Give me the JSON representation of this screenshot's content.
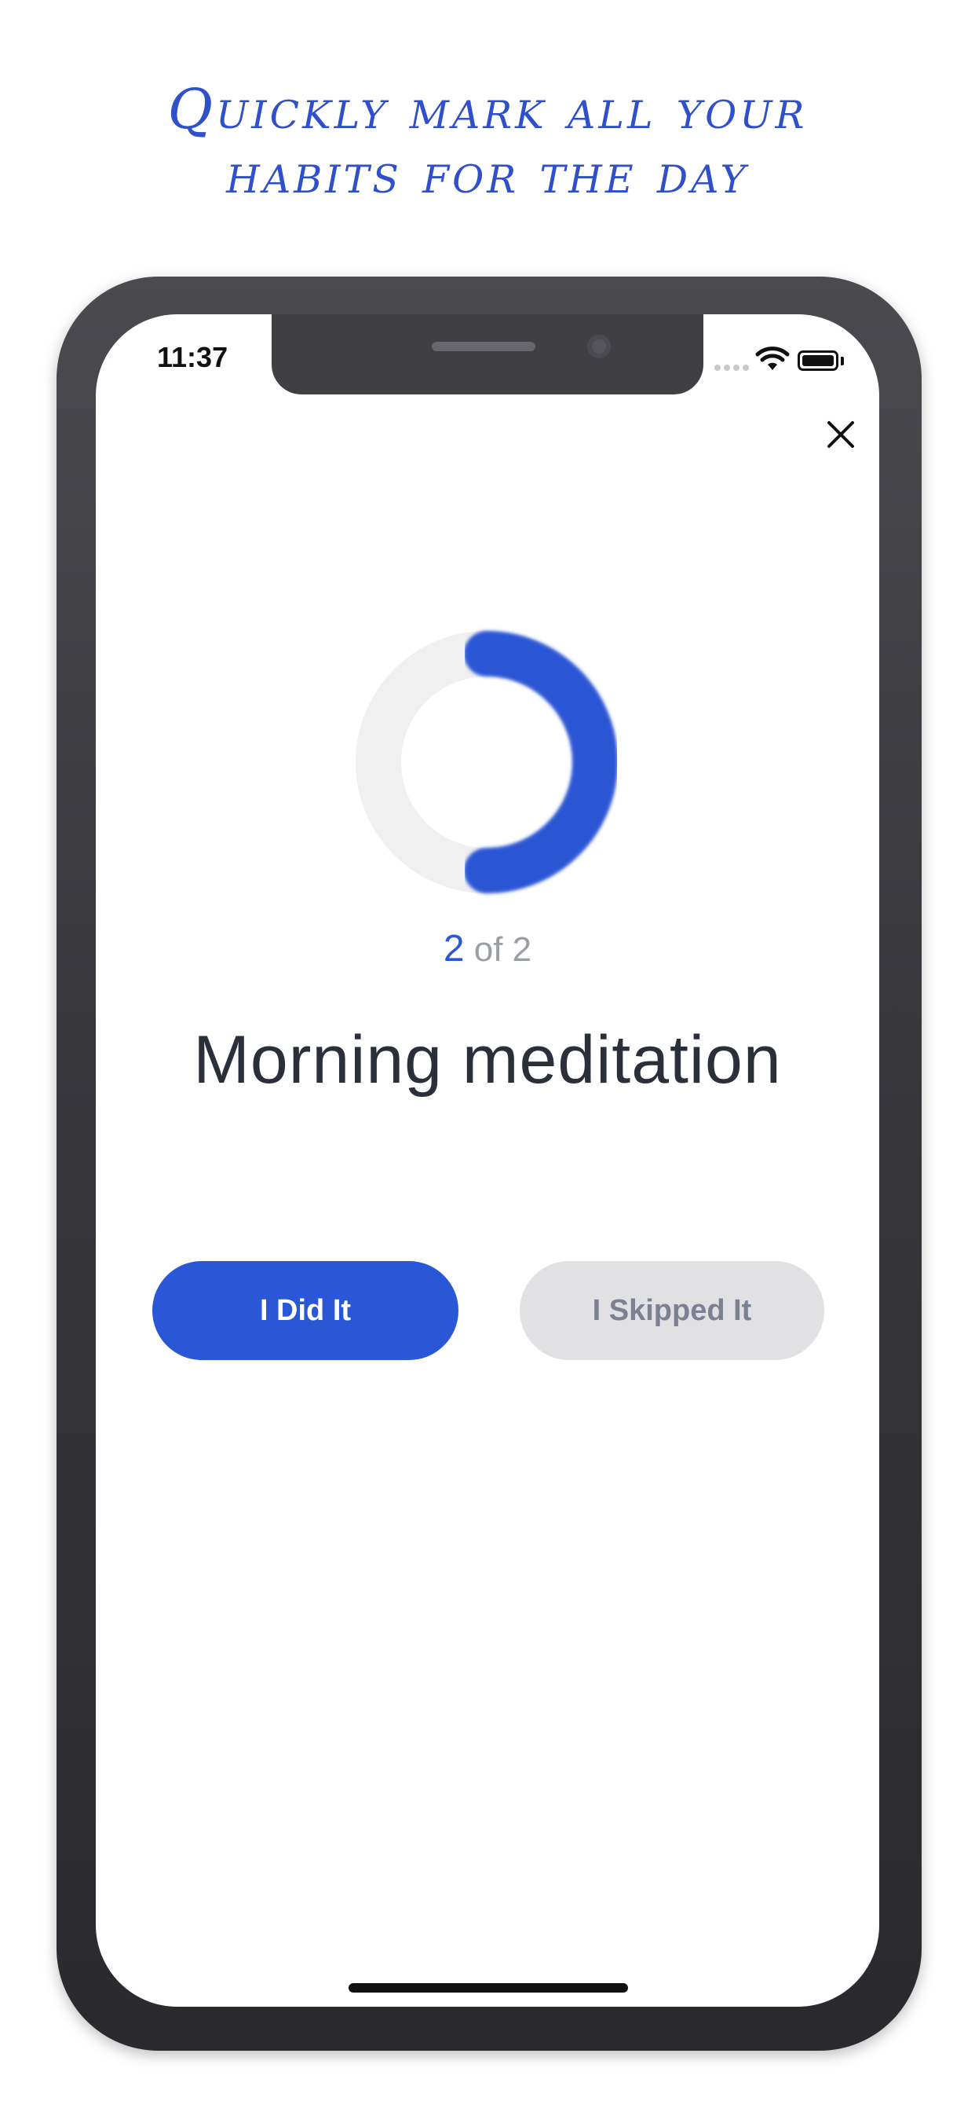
{
  "headline": {
    "line1": "Quickly mark all your",
    "line2": "habits for the day"
  },
  "status_bar": {
    "time": "11:37",
    "icons": [
      "signal-dots-icon",
      "wifi-icon",
      "battery-icon"
    ]
  },
  "header": {
    "close_icon": "close-icon"
  },
  "progress": {
    "current": "2",
    "separator": "of 2",
    "fraction_complete": 0.5,
    "accent_color": "#2a57d6",
    "track_color": "#f0f0f0"
  },
  "habit": {
    "title": "Morning meditation"
  },
  "actions": {
    "did_label": "I Did It",
    "skip_label": "I Skipped It"
  },
  "colors": {
    "headline": "#2f50c8",
    "primary": "#2a57d6",
    "secondary_bg": "#e1e1e3",
    "text_dark": "#2a2f3a"
  }
}
